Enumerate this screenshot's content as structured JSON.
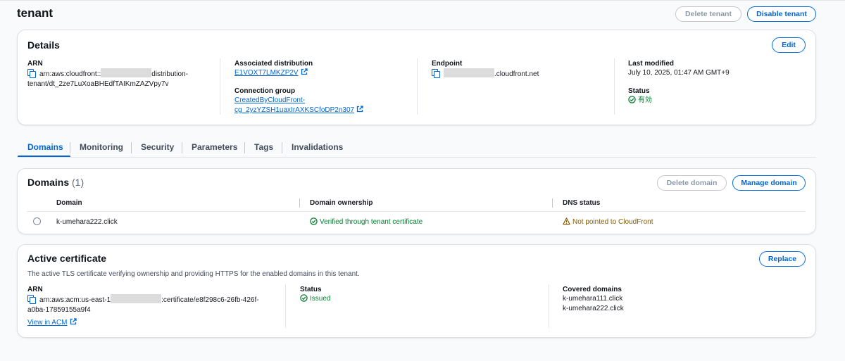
{
  "header": {
    "title": "tenant",
    "delete_label": "Delete tenant",
    "disable_label": "Disable tenant"
  },
  "details": {
    "title": "Details",
    "edit_label": "Edit",
    "arn_label": "ARN",
    "arn_prefix": "arn:aws:cloudfront::",
    "arn_suffix": "distribution-",
    "arn_line2": "tenant/dt_2ze7LuXoaBHEdfTAIKmZAZVpy7v",
    "assoc_label": "Associated distribution",
    "assoc_value": "E1VOXT7LMKZP2V",
    "conn_label": "Connection group",
    "conn_line1": "CreatedByCloudFront-",
    "conn_line2": "cg_2yzYZSH1uaxIrAXKSCfoDP2n307",
    "endpoint_label": "Endpoint",
    "endpoint_suffix": ".cloudfront.net",
    "modified_label": "Last modified",
    "modified_value": "July 10, 2025, 01:47 AM GMT+9",
    "status_label": "Status",
    "status_value": "有効"
  },
  "tabs": [
    "Domains",
    "Monitoring",
    "Security",
    "Parameters",
    "Tags",
    "Invalidations"
  ],
  "domains": {
    "title": "Domains",
    "count": "(1)",
    "delete_label": "Delete domain",
    "manage_label": "Manage domain",
    "columns": [
      "Domain",
      "Domain ownership",
      "DNS status"
    ],
    "rows": [
      {
        "domain": "k-umehara222.click",
        "ownership": "Verified through tenant certificate",
        "dns": "Not pointed to CloudFront"
      }
    ]
  },
  "certificate": {
    "title": "Active certificate",
    "replace_label": "Replace",
    "description": "The active TLS certificate verifying ownership and providing HTTPS for the enabled domains in this tenant.",
    "arn_label": "ARN",
    "arn_prefix": "arn:aws:acm:us-east-1",
    "arn_suffix": ":certificate/e8f298c6-26fb-426f-",
    "arn_line2": "a0ba-17859155a9f4",
    "view_label": "View in ACM",
    "status_label": "Status",
    "status_value": "Issued",
    "covered_label": "Covered domains",
    "covered": [
      "k-umehara111.click",
      "k-umehara222.click"
    ]
  },
  "colors": {
    "primary": "#0066d6",
    "success": "#00802f",
    "warning": "#855900"
  }
}
